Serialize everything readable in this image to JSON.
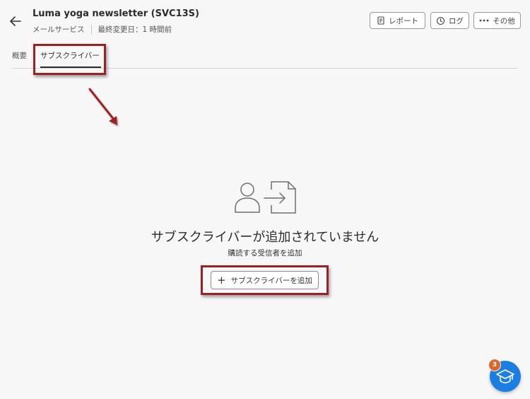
{
  "header": {
    "title": "Luma yoga newsletter (SVC13S)",
    "service_type": "メールサービス",
    "last_modified": "最終変更日：1 時間前",
    "buttons": {
      "report": "レポート",
      "log": "ログ",
      "more": "その他"
    }
  },
  "tabs": {
    "overview": "概要",
    "subscribers": "サブスクライバー",
    "active": "subscribers"
  },
  "empty_state": {
    "title": "サブスクライバーが追加されていません",
    "subtitle": "購読する受信者を追加",
    "add_button_label": "サブスクライバーを追加"
  },
  "help": {
    "badge_count": "3"
  },
  "colors": {
    "highlight": "#9b2222",
    "fab": "#1b7ee0",
    "badge": "#d9692a"
  },
  "icons": [
    "arrow-left-icon",
    "report-icon",
    "history-icon",
    "more-icon",
    "user-import-icon",
    "plus-icon",
    "graduation-cap-icon"
  ]
}
